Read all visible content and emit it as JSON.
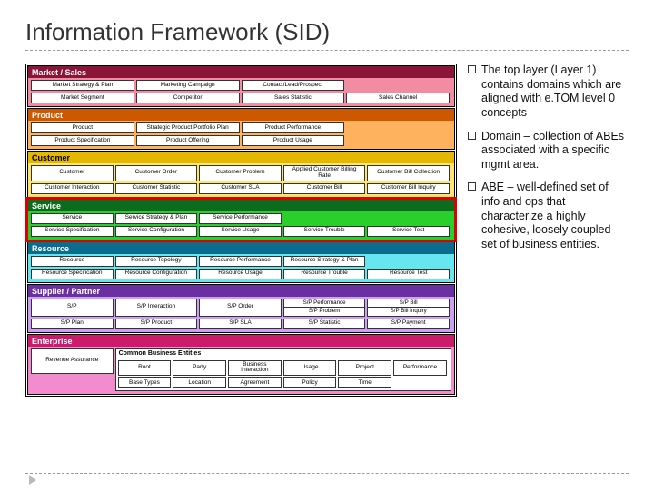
{
  "title": "Information Framework (SID)",
  "domains": {
    "market": {
      "label": "Market / Sales",
      "abes": [
        "Market Strategy & Plan",
        "Marketing Campaign",
        "Contact/Lead/Prospect",
        "",
        "Market Segment",
        "Competitor",
        "Sales Statistic",
        "Sales Channel"
      ]
    },
    "product": {
      "label": "Product",
      "abes": [
        "Product",
        "Strategic Product Portfolio Plan",
        "Product Performance",
        "",
        "Product Specification",
        "Product Offering",
        "Product Usage",
        ""
      ]
    },
    "customer": {
      "label": "Customer",
      "abes": [
        "Customer",
        "Customer Order",
        "Customer Problem",
        "Applied Customer Billing Rate",
        "Customer Bill Collection",
        "Customer Interaction",
        "Customer Statistic",
        "Customer SLA",
        "Customer Bill",
        "Customer Bill Inquiry"
      ]
    },
    "service": {
      "label": "Service",
      "abes": [
        "Service",
        "Service Strategy & Plan",
        "Service Performance",
        "",
        "",
        "Service Specification",
        "Service Configuration",
        "Service Usage",
        "Service Trouble",
        "Service Test"
      ]
    },
    "resource": {
      "label": "Resource",
      "abes": [
        "Resource",
        "Resource Topology",
        "Resource Performance",
        "Resource Strategy & Plan",
        "",
        "Resource Specification",
        "Resource Configuration",
        "Resource Usage",
        "Resource Trouble",
        "Resource Test"
      ]
    },
    "supplier": {
      "label": "Supplier / Partner",
      "abes": [
        "S/P",
        "S/P Interaction",
        "S/P Order",
        "S/P Performance|S/P Problem",
        "S/P Bill|S/P Bill Inquiry",
        "S/P Plan",
        "S/P Product",
        "S/P SLA",
        "S/P Statistic",
        "S/P Payment"
      ]
    },
    "enterprise": {
      "label": "Enterprise",
      "left": "Revenue Assurance",
      "cbe_title": "Common Business Entities",
      "cbe_rows": [
        [
          "Root",
          "Party",
          "Business Interaction",
          "Usage",
          "Project",
          "Performance"
        ],
        [
          "Base Types",
          "Location",
          "Agreement",
          "Policy",
          "Time",
          ""
        ]
      ]
    }
  },
  "notes": [
    "The top layer (Layer 1) contains domains which are aligned with e.TOM level 0 concepts",
    "Domain – collection of ABEs associated with a specific mgmt area.",
    "ABE – well-defined set of info and ops that characterize a highly cohesive, loosely coupled set of business entities."
  ]
}
